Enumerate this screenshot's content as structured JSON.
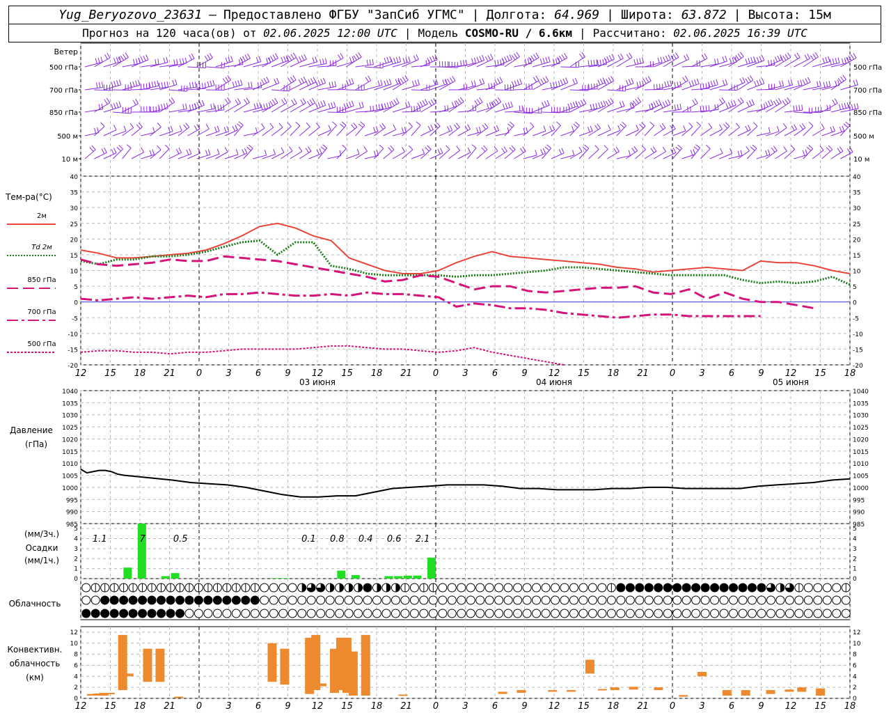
{
  "header": {
    "station": "Yug_Beryozovo_23631",
    "provider": "Предоставлено ФГБУ \"ЗапСиб УГМС\"",
    "lon_label": "Долгота:",
    "lon": "64.969",
    "lat_label": "Широта:",
    "lat": "63.872",
    "alt_label": "Высота:",
    "alt": "15м",
    "forecast_prefix": "Прогноз на 120 часа(ов) от",
    "forecast_start": "02.06.2025 12:00 UTC",
    "model_label": "Модель",
    "model": "COSMO-RU / 6.6км",
    "computed_label": "Рассчитано:",
    "computed": "02.06.2025 16:39 UTC"
  },
  "time_axis": {
    "hour_ticks": [
      "12",
      "15",
      "18",
      "21",
      "0",
      "3",
      "6",
      "9",
      "12",
      "15",
      "18",
      "21",
      "0",
      "3",
      "6",
      "9",
      "12",
      "15",
      "18",
      "21",
      "0",
      "3",
      "6",
      "9",
      "12",
      "15",
      "18"
    ],
    "day_labels": [
      {
        "hour": 36,
        "label": "03 июня"
      },
      {
        "hour": 60,
        "label": "04 июня"
      },
      {
        "hour": 84,
        "label": "05 июня"
      }
    ]
  },
  "wind_panel": {
    "title": "Ветер",
    "levels": [
      "500 гПа",
      "700 гПа",
      "850 гПа",
      "500 м",
      "10 м"
    ],
    "barb_color": "#8a2be2"
  },
  "chart_data": [
    {
      "type": "line",
      "title": "Тем-ра(°C)",
      "ylim": [
        -20,
        40
      ],
      "y_ticks": [
        40,
        35,
        30,
        25,
        20,
        15,
        10,
        5,
        0,
        -5,
        -10,
        -15,
        -20
      ],
      "x_hours": [
        0,
        3,
        6,
        9,
        12,
        15,
        18,
        21,
        24,
        27,
        30,
        33,
        36,
        39,
        42,
        45,
        48,
        51,
        54,
        57,
        60,
        63,
        66,
        69,
        72,
        75,
        78,
        81,
        84,
        87,
        90,
        93,
        96,
        99,
        102,
        105,
        108,
        111,
        114,
        117,
        120,
        123,
        126,
        129,
        132,
        135,
        138,
        141,
        144,
        147,
        150,
        153,
        156,
        159,
        162
      ],
      "series": [
        {
          "name": "2м",
          "color": "#e8463a",
          "style": "solid",
          "values": [
            16.5,
            15.5,
            14,
            14,
            14.5,
            15,
            15.5,
            16.5,
            18.5,
            21,
            24,
            25,
            23.5,
            21,
            19.5,
            14,
            12,
            10,
            9,
            9,
            10,
            12.5,
            14.5,
            16,
            14.5,
            14,
            13.5,
            13,
            12.5,
            12,
            11,
            10.5,
            9.5,
            10,
            10.5,
            11,
            10.5,
            10,
            13,
            12.5,
            12.5,
            11.5,
            10,
            9
          ]
        },
        {
          "name": "Td 2м",
          "color": "#1b7a1b",
          "style": "dot",
          "values": [
            13,
            12,
            13.5,
            13.5,
            14.5,
            14.5,
            15,
            16,
            17.5,
            19,
            19.5,
            15,
            19,
            19,
            11.5,
            10.5,
            9,
            8.5,
            8.5,
            8.5,
            8.5,
            8,
            8.5,
            8.5,
            9,
            9.5,
            10,
            11,
            11,
            10.5,
            10,
            9.5,
            9,
            8.5,
            8.5,
            8.5,
            8.5,
            7,
            6,
            6.5,
            6,
            6.5,
            8,
            5.5
          ]
        },
        {
          "name": "850 гПа",
          "color": "#d4147a",
          "style": "dash",
          "values": [
            13.5,
            12,
            11.5,
            12,
            12.5,
            13.5,
            13,
            13,
            14.5,
            14,
            13.5,
            13,
            12,
            11,
            10,
            9,
            8,
            6.5,
            7,
            8.5,
            8,
            6,
            4,
            5,
            5,
            3.5,
            3,
            3.5,
            4,
            4.5,
            4.5,
            5,
            3,
            2.5,
            4,
            1,
            3,
            1,
            0,
            0,
            -1,
            -2
          ]
        },
        {
          "name": "700 гПа",
          "color": "#d4147a",
          "style": "dashdot",
          "values": [
            1,
            0.5,
            1,
            1.5,
            1,
            1.5,
            2,
            1.5,
            2.5,
            2.5,
            3,
            2.5,
            2,
            2,
            2.5,
            2,
            3,
            2.5,
            2.5,
            2,
            1.5,
            -1.5,
            -0.5,
            -1,
            -2,
            -2,
            -2.5,
            -3.5,
            -4,
            -4.5,
            -5,
            -4.5,
            -4,
            -4,
            -4.5,
            -4.5,
            -4.5,
            -4.5,
            -4.5
          ]
        },
        {
          "name": "500 гПа",
          "color": "#d4147a",
          "style": "fine",
          "values": [
            -16,
            -15.5,
            -15.5,
            -16,
            -16,
            -16.5,
            -16,
            -16,
            -15.5,
            -15,
            -15,
            -15,
            -15,
            -14.5,
            -14,
            -14,
            -14.5,
            -15,
            -15,
            -15.5,
            -16,
            -15.5,
            -14.5,
            -16,
            -17,
            -18,
            -19,
            -20
          ]
        }
      ]
    },
    {
      "type": "line",
      "title": "Давление",
      "ylabel": "(гПа)",
      "ylim": [
        985,
        1040
      ],
      "y_ticks": [
        1040,
        1035,
        1030,
        1025,
        1020,
        1015,
        1010,
        1005,
        1000,
        995,
        990,
        985
      ],
      "x_hours": [
        0,
        1,
        3,
        4,
        5,
        6,
        7,
        9,
        11,
        13,
        15,
        18,
        21,
        24,
        27,
        30,
        33,
        36,
        39,
        42,
        45,
        48,
        51,
        54,
        57,
        60,
        63,
        66,
        69,
        72,
        75,
        78,
        81,
        84,
        87,
        90,
        93,
        96,
        99,
        102,
        105,
        108,
        111,
        114,
        117,
        120,
        123,
        126
      ],
      "series": [
        {
          "name": "Давление",
          "color": "#000000",
          "values": [
            1007.5,
            1006,
            1007,
            1007,
            1006.5,
            1005.5,
            1005,
            1004.5,
            1004,
            1003.5,
            1003,
            1002,
            1001.5,
            1001,
            1000,
            998.5,
            997,
            996,
            996,
            996.5,
            996.5,
            998,
            999.5,
            1000,
            1000.5,
            1001,
            1001,
            1001,
            1000.5,
            999.5,
            999.5,
            999,
            999,
            999,
            999.5,
            999.5,
            1000,
            1000,
            999.5,
            999.5,
            999.5,
            999.5,
            1000.5,
            1001,
            1001.5,
            1002,
            1003,
            1003.5
          ]
        }
      ]
    },
    {
      "type": "bar",
      "title": "Осадки",
      "ylabel": "(мм/3ч.) (мм/1ч.)",
      "ylim": [
        0,
        5.5
      ],
      "y_ticks": [
        5,
        4,
        3,
        2,
        1,
        0
      ],
      "bar_color": "#22dd22",
      "bars": [
        {
          "hour": 9,
          "value": 1.1
        },
        {
          "hour": 12,
          "value": 5.5
        },
        {
          "hour": 17,
          "value": 0.25
        },
        {
          "hour": 19,
          "value": 0.55
        },
        {
          "hour": 54,
          "value": 0.8
        },
        {
          "hour": 57,
          "value": 0.35
        },
        {
          "hour": 64,
          "value": 0.25
        },
        {
          "hour": 66,
          "value": 0.25
        },
        {
          "hour": 68,
          "value": 0.3
        },
        {
          "hour": 70,
          "value": 0.3
        },
        {
          "hour": 73,
          "value": 2.1
        },
        {
          "hour": 40,
          "value": 0.05
        },
        {
          "hour": 42,
          "value": 0.05
        }
      ],
      "sums": [
        {
          "hour": 4,
          "value": "1.1"
        },
        {
          "hour": 13,
          "value": "7"
        },
        {
          "hour": 21,
          "value": "0.5"
        },
        {
          "hour": 48,
          "value": "0.1"
        },
        {
          "hour": 54,
          "value": "0.8"
        },
        {
          "hour": 60,
          "value": "0.4"
        },
        {
          "hour": 66,
          "value": "0.6"
        },
        {
          "hour": 72,
          "value": "2.1"
        }
      ]
    },
    {
      "type": "bar",
      "title": "Конвективн. облачность",
      "ylabel": "(км)",
      "ylim": [
        0,
        13
      ],
      "y_ticks": [
        12,
        10,
        8,
        6,
        4,
        2,
        0
      ],
      "bar_color": "#ee8a2e",
      "bars": [
        {
          "hour": 1,
          "bottom": 0.5,
          "top": 0.8
        },
        {
          "hour": 2,
          "bottom": 0.5,
          "top": 0.9
        },
        {
          "hour": 3,
          "bottom": 0.5,
          "top": 1.0
        },
        {
          "hour": 4,
          "bottom": 0.8,
          "top": 1.0
        },
        {
          "hour": 6,
          "bottom": 1.5,
          "top": 11.5
        },
        {
          "hour": 7,
          "bottom": 4.0,
          "top": 4.5
        },
        {
          "hour": 10,
          "bottom": 3.0,
          "top": 9.0
        },
        {
          "hour": 12,
          "bottom": 3.0,
          "top": 9.0
        },
        {
          "hour": 15,
          "bottom": 0.2,
          "top": 0.3
        },
        {
          "hour": 30,
          "bottom": 3.0,
          "top": 10.0
        },
        {
          "hour": 32,
          "bottom": 2.5,
          "top": 9.0
        },
        {
          "hour": 36,
          "bottom": 0.8,
          "top": 11.0
        },
        {
          "hour": 37,
          "bottom": 1.5,
          "top": 11.5
        },
        {
          "hour": 38,
          "bottom": 2.2,
          "top": 2.7
        },
        {
          "hour": 40,
          "bottom": 1.0,
          "top": 9.0
        },
        {
          "hour": 41,
          "bottom": 1.5,
          "top": 11.0
        },
        {
          "hour": 42,
          "bottom": 1.0,
          "top": 11.0
        },
        {
          "hour": 43,
          "bottom": 0.5,
          "top": 8.5
        },
        {
          "hour": 45,
          "bottom": 0.5,
          "top": 11.5
        },
        {
          "hour": 51,
          "bottom": 0.5,
          "top": 0.7
        },
        {
          "hour": 67,
          "bottom": 0.8,
          "top": 1.2
        },
        {
          "hour": 70,
          "bottom": 1.0,
          "top": 1.5
        },
        {
          "hour": 75,
          "bottom": 1.2,
          "top": 1.5
        },
        {
          "hour": 78,
          "bottom": 1.2,
          "top": 1.5
        },
        {
          "hour": 81,
          "bottom": 4.5,
          "top": 7.0
        },
        {
          "hour": 83,
          "bottom": 1.5,
          "top": 1.7
        },
        {
          "hour": 85,
          "bottom": 1.5,
          "top": 2.0
        },
        {
          "hour": 88,
          "bottom": 1.6,
          "top": 2.1
        },
        {
          "hour": 92,
          "bottom": 1.5,
          "top": 2.0
        },
        {
          "hour": 96,
          "bottom": 0.3,
          "top": 0.6
        },
        {
          "hour": 99,
          "bottom": 4.0,
          "top": 4.8
        },
        {
          "hour": 103,
          "bottom": 0.5,
          "top": 1.5
        },
        {
          "hour": 106,
          "bottom": 0.5,
          "top": 1.5
        },
        {
          "hour": 110,
          "bottom": 0.8,
          "top": 1.5
        },
        {
          "hour": 113,
          "bottom": 1.2,
          "top": 1.6
        },
        {
          "hour": 115,
          "bottom": 1.2,
          "top": 2.0
        },
        {
          "hour": 118,
          "bottom": 0.5,
          "top": 1.8
        }
      ]
    }
  ],
  "cloud_panel": {
    "title": "Облачность",
    "rows": [
      "0111111111111111111000023322224222101100000000000000000014444444444444444323100001111100000",
      "0044444444444444444000000000000000000000000000000000000000000000000000000000000000000000000",
      "4444444444400000000000000000000000000000000000000000000000000000000000000000000000000000000"
    ]
  },
  "temp_legend": {
    "title": "Тем-ра(°C)",
    "entries": [
      "2м",
      "Td 2м",
      "850 гПа",
      "700 гПа",
      "500 гПа"
    ]
  }
}
